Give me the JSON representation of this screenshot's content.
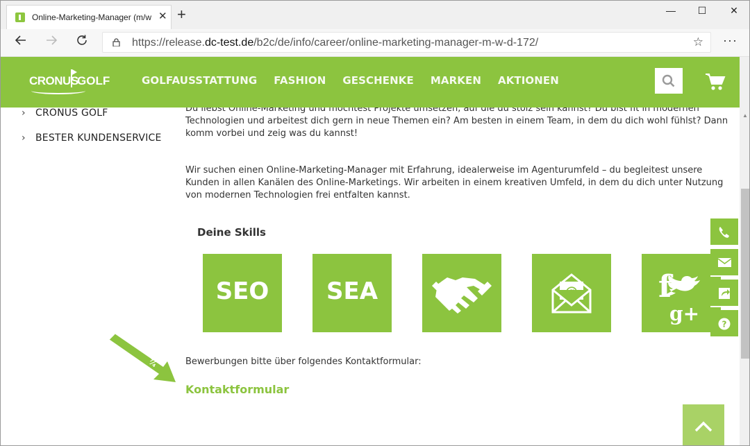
{
  "browser": {
    "tab_title": "Online-Marketing-Manager (m/w",
    "tab_close": "✕",
    "new_tab": "+",
    "minimize": "—",
    "maximize": "☐",
    "close": "✕",
    "url_prefix": "https://release.",
    "url_domain": "dc-test.de",
    "url_path": "/b2c/de/info/career/online-marketing-manager-m-w-d-172/",
    "menu": "···"
  },
  "header": {
    "logo_left": "CRONUS",
    "logo_right": "GOLF",
    "nav": [
      "GOLFAUSSTATTUNG",
      "FASHION",
      "GESCHENKE",
      "MARKEN",
      "AKTIONEN"
    ]
  },
  "sidebar": {
    "items": [
      "CRONUS GOLF",
      "BESTER KUNDENSERVICE"
    ],
    "chevron": "›"
  },
  "main": {
    "intro": "Du liebst Online-Marketing und möchtest Projekte umsetzen, auf die du stolz sein kannst? Du bist fit in modernen Technologien und arbeitest dich gern in neue Themen ein? Am besten in einem Team, in dem du dich wohl fühlst? Dann komm vorbei und zeig was du kannst!",
    "description": "Wir suchen einen Online-Marketing-Manager mit Erfahrung, idealerweise im Agenturumfeld – du begleitest unsere Kunden in allen Kanälen des Online-Marketings. Wir arbeiten in einem kreativen Umfeld, in dem du dich unter Nutzung von modernen Technologien frei entfalten kannst.",
    "skills_heading": "Deine Skills",
    "skills": [
      "SEO",
      "SEA"
    ],
    "application_note": "Bewerbungen bitte über folgendes Kontaktformular:",
    "contact_link": "Kontaktformular"
  },
  "colors": {
    "brand_green": "#8cc43f",
    "light_green": "#a9d266"
  }
}
